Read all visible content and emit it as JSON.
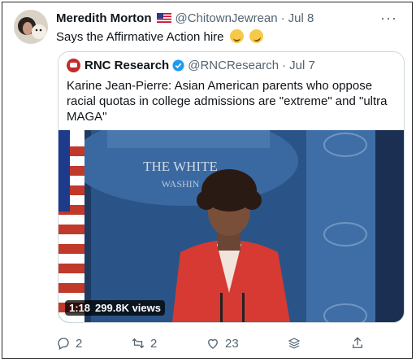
{
  "tweet": {
    "author_name": "Meredith Morton",
    "handle": "@ChitownJewrean",
    "separator": "·",
    "date": "Jul 8",
    "text": "Says the Affirmative Action hire",
    "more_label": "···"
  },
  "quoted": {
    "author_name": "RNC Research",
    "handle": "@RNCResearch",
    "separator": "·",
    "date": "Jul 7",
    "text": "Karine Jean-Pierre: Asian American parents who oppose racial quotas in college admissions are \"extreme\" and \"ultra MAGA\"",
    "video": {
      "duration": "1:18",
      "views": "299.8K views",
      "backdrop_text_1": "THE WHITE",
      "backdrop_text_2": "WASHIN"
    }
  },
  "actions": {
    "replies": "2",
    "retweets": "2",
    "likes": "23"
  },
  "colors": {
    "verified": "#1d9bf0",
    "muted": "#536471",
    "backdrop_blue": "#2f5f9e",
    "jacket_red": "#d63a33"
  }
}
